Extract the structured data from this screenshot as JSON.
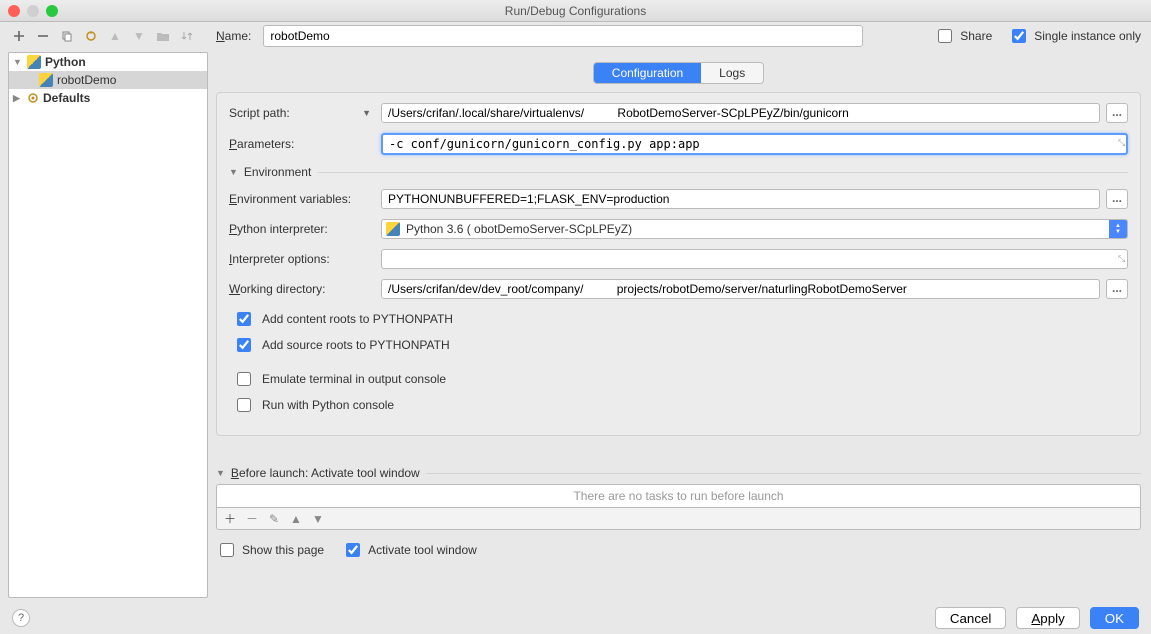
{
  "window": {
    "title": "Run/Debug Configurations"
  },
  "toolbar": {
    "name_label": "Name:",
    "name_value": "robotDemo",
    "share_label": "Share",
    "single_instance_label": "Single instance only",
    "share_checked": false,
    "single_instance_checked": true
  },
  "tree": {
    "python_label": "Python",
    "config_item": "robotDemo",
    "defaults_label": "Defaults"
  },
  "tabs": {
    "configuration": "Configuration",
    "logs": "Logs"
  },
  "form": {
    "script_path_label": "Script path:",
    "script_path_value": "/Users/crifan/.local/share/virtualenvs/          RobotDemoServer-SCpLPEyZ/bin/gunicorn",
    "parameters_label": "Parameters:",
    "parameters_value": "-c conf/gunicorn/gunicorn_config.py app:app",
    "environment_section": "Environment",
    "env_vars_label": "Environment variables:",
    "env_vars_value": "PYTHONUNBUFFERED=1;FLASK_ENV=production",
    "interpreter_label": "Python interpreter:",
    "interpreter_value": "Python 3.6 (          obotDemoServer-SCpLPEyZ)",
    "interpreter_options_label": "Interpreter options:",
    "interpreter_options_value": "",
    "working_dir_label": "Working directory:",
    "working_dir_value": "/Users/crifan/dev/dev_root/company/          projects/robotDemo/server/naturlingRobotDemoServer",
    "add_content_roots": "Add content roots to PYTHONPATH",
    "add_source_roots": "Add source roots to PYTHONPATH",
    "emulate_terminal": "Emulate terminal in output console",
    "run_python_console": "Run with Python console"
  },
  "before_launch": {
    "header": "Before launch: Activate tool window",
    "empty_text": "There are no tasks to run before launch",
    "show_this_page": "Show this page",
    "activate_tool_window": "Activate tool window"
  },
  "buttons": {
    "cancel": "Cancel",
    "apply": "Apply",
    "ok": "OK"
  },
  "dots": "..."
}
